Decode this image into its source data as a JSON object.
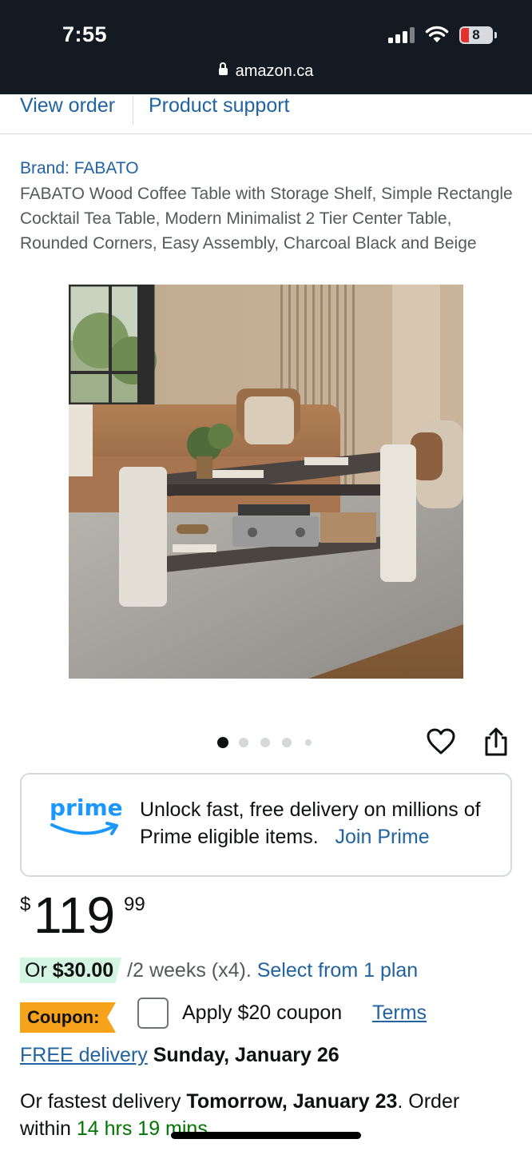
{
  "status_bar": {
    "time": "7:55",
    "battery_level": "8",
    "url": "amazon.ca"
  },
  "nav": {
    "view_order": "View order",
    "product_support": "Product support"
  },
  "product": {
    "brand": "Brand: FABATO",
    "title": "FABATO Wood Coffee Table with Storage Shelf, Simple Rectangle Cocktail Tea Table, Modern Minimalist 2 Tier Center Table, Rounded Corners, Easy Assembly, Charcoal Black and Beige",
    "image_description_icon": "product-photo",
    "image_count": 5,
    "active_image_index": 0
  },
  "prime": {
    "logo_text": "prime",
    "message": "Unlock fast, free delivery on millions of Prime eligible items.",
    "join_label": "Join Prime"
  },
  "price": {
    "symbol": "$",
    "whole": "119",
    "fraction": "99"
  },
  "installment": {
    "prefix": "Or",
    "amount": "$30.00",
    "term": "/2 weeks (x4).",
    "plan_link": "Select from 1 plan"
  },
  "coupon": {
    "badge": "Coupon:",
    "label": "Apply $20 coupon",
    "terms": "Terms",
    "checked": false
  },
  "delivery": {
    "free_label": "FREE delivery",
    "free_date": "Sunday, January 26",
    "fastest_prefix": "Or fastest delivery",
    "fastest_date": "Tomorrow, January 23",
    "order_within": ". Order within",
    "countdown": "14 hrs 19 mins"
  },
  "colors": {
    "link": "#2162a1",
    "header_bg": "#131a22",
    "coupon_badge": "#f7a21b",
    "installment_bg": "#d5f5e3",
    "countdown": "#007600"
  }
}
